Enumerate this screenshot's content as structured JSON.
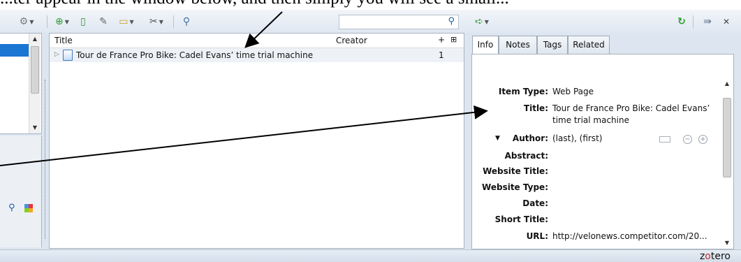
{
  "doc_caption": "...ter appear in the window below, and then simply you will see a small...",
  "toolbar": {
    "icons": [
      "gear-icon",
      "new-collection-icon",
      "new-item-icon",
      "add-by-identifier-icon",
      "new-note-icon",
      "attachment-icon",
      "advanced-search-icon"
    ],
    "search_placeholder": ""
  },
  "items_pane": {
    "columns": {
      "title": "Title",
      "creator": "Creator",
      "plus": "+",
      "menu": "⊞"
    },
    "rows": [
      {
        "title": "Tour de France Pro Bike: Cadel Evans’ time trial machine",
        "count": "1"
      }
    ]
  },
  "item_pane": {
    "tabs": [
      {
        "label": "Info",
        "active": true
      },
      {
        "label": "Notes",
        "active": false
      },
      {
        "label": "Tags",
        "active": false
      },
      {
        "label": "Related",
        "active": false
      }
    ],
    "fields": {
      "item_type_label": "Item Type:",
      "item_type": "Web Page",
      "title_label": "Title:",
      "title_line1": "Tour de France Pro Bike: Cadel Evans’",
      "title_line2": "time trial machine",
      "author_label": "Author:",
      "author_value": "(last), (first)",
      "abstract_label": "Abstract:",
      "website_title_label": "Website Title:",
      "website_type_label": "Website Type:",
      "date_label": "Date:",
      "short_title_label": "Short Title:",
      "url_label": "URL:",
      "url_value": "http://velonews.competitor.com/20..."
    }
  },
  "statusbar": {
    "brand_z": "z",
    "brand_o": "o",
    "brand_rest": "tero"
  },
  "colors": {
    "selection_blue": "#1b75d3",
    "arrow_black": "#000000",
    "brand_red": "#c72e2e"
  }
}
